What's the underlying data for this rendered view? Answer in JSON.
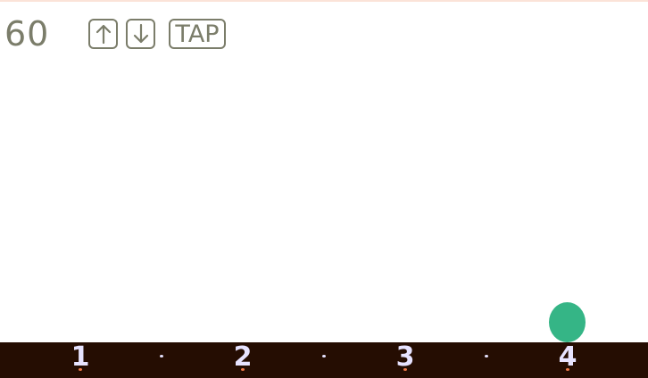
{
  "tempo": {
    "bpm": "60"
  },
  "controls": {
    "up_icon": "arrow-up-icon",
    "down_icon": "arrow-down-icon",
    "tap_label": "TAP"
  },
  "beats": [
    {
      "label": "1"
    },
    {
      "label": "2"
    },
    {
      "label": "3"
    },
    {
      "label": "4"
    }
  ],
  "colors": {
    "text": "#7b7d6a",
    "ball": "#35b586",
    "bar_background": "#250d02",
    "beat_number": "#e7e3ff",
    "beat_accent": "#f07a4a",
    "top_line": "#fbe3d8"
  }
}
